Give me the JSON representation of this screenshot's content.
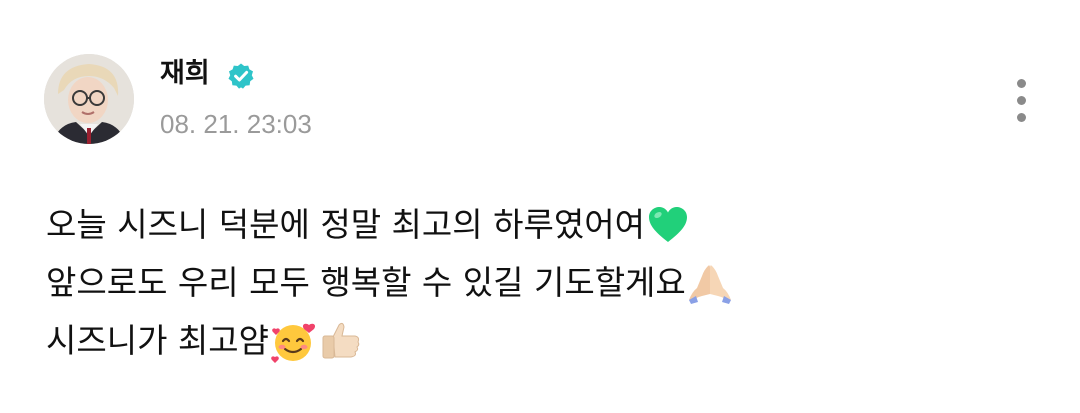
{
  "post": {
    "author": {
      "name": "재희",
      "verified": true,
      "avatar_icon": "profile-photo"
    },
    "timestamp": "08. 21. 23:03",
    "more_icon": "more-vertical-icon",
    "lines": [
      {
        "text": "오늘 시즈니 덕분에 정말 최고의 하루였어여",
        "emoji": "green-heart-icon"
      },
      {
        "text": "앞으로도 우리 모두 행복할 수 있길 기도할게요",
        "emoji": "folded-hands-icon"
      },
      {
        "text": "시즈니가 최고얌",
        "emoji": [
          "smiling-face-with-hearts-icon",
          "thumbs-up-icon"
        ]
      }
    ]
  },
  "colors": {
    "verified_badge": "#2ec4c9",
    "timestamp": "#9a9a9a",
    "more_dots": "#8a8a8a",
    "green_heart": "#21d07a"
  }
}
